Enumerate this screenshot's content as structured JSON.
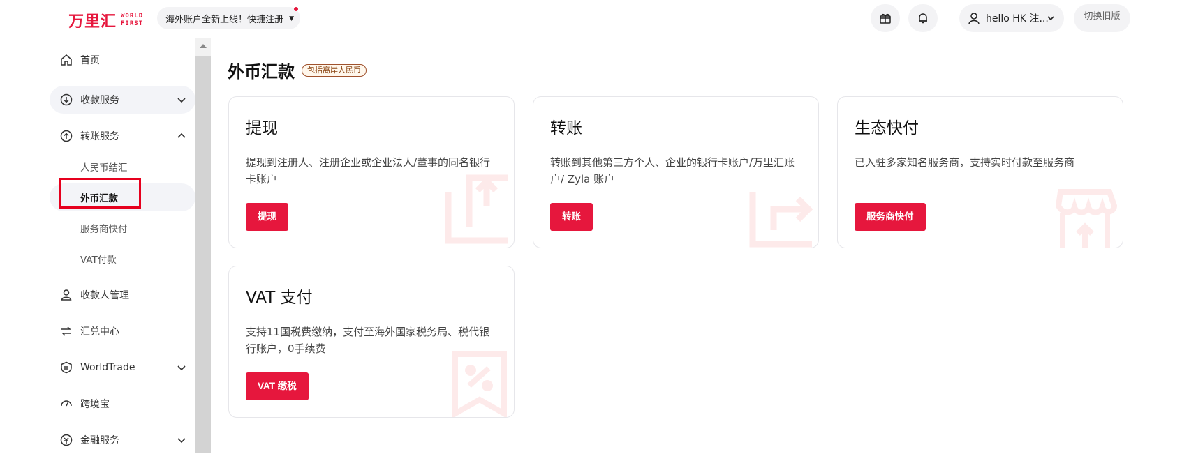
{
  "header": {
    "logo_cn": "万里汇",
    "logo_en_line1": "WORLD",
    "logo_en_line2": "FIRST",
    "promo_text": "海外账户全新上线！快捷注册",
    "user_name": "hello HK 注...",
    "old_version_label": "切换旧版",
    "icons": [
      "gift-icon",
      "bell-icon",
      "user-icon",
      "chevron-down-icon"
    ]
  },
  "sidebar": {
    "items": [
      {
        "label": "首页",
        "icon": "home-icon"
      },
      {
        "label": "收款服务",
        "icon": "receive-icon"
      },
      {
        "label": "转账服务",
        "icon": "transfer-icon"
      },
      {
        "label": "收款人管理",
        "icon": "payee-icon"
      },
      {
        "label": "汇兑中心",
        "icon": "exchange-icon"
      },
      {
        "label": "WorldTrade",
        "icon": "worldtrade-icon"
      },
      {
        "label": "跨境宝",
        "icon": "crossborder-icon"
      },
      {
        "label": "金融服务",
        "icon": "finance-icon"
      }
    ],
    "sub_items": [
      {
        "label": "人民币结汇"
      },
      {
        "label": "外币汇款"
      },
      {
        "label": "服务商快付"
      },
      {
        "label": "VAT付款"
      }
    ]
  },
  "main": {
    "title": "外币汇款",
    "badge": "包括离岸人民币",
    "cards": [
      {
        "title": "提现",
        "desc": "提现到注册人、注册企业或企业法人/董事的同名银行卡账户",
        "button": "提现",
        "watermark_icon": "withdraw-icon"
      },
      {
        "title": "转账",
        "desc": "转账到其他第三方个人、企业的银行卡账户/万里汇账户/ Zyla 账户",
        "button": "转账",
        "watermark_icon": "transfer-out-icon"
      },
      {
        "title": "生态快付",
        "desc": "已入驻多家知名服务商，支持实时付款至服务商",
        "button": "服务商快付",
        "watermark_icon": "shop-icon"
      },
      {
        "title": "VAT 支付",
        "desc": "支持11国税费缴纳，支付至海外国家税务局、税代银行账户，0手续费",
        "button": "VAT 缴税",
        "watermark_icon": "tax-icon"
      }
    ]
  },
  "colors": {
    "brand": "#e6173d",
    "highlight": "#e6001e"
  }
}
